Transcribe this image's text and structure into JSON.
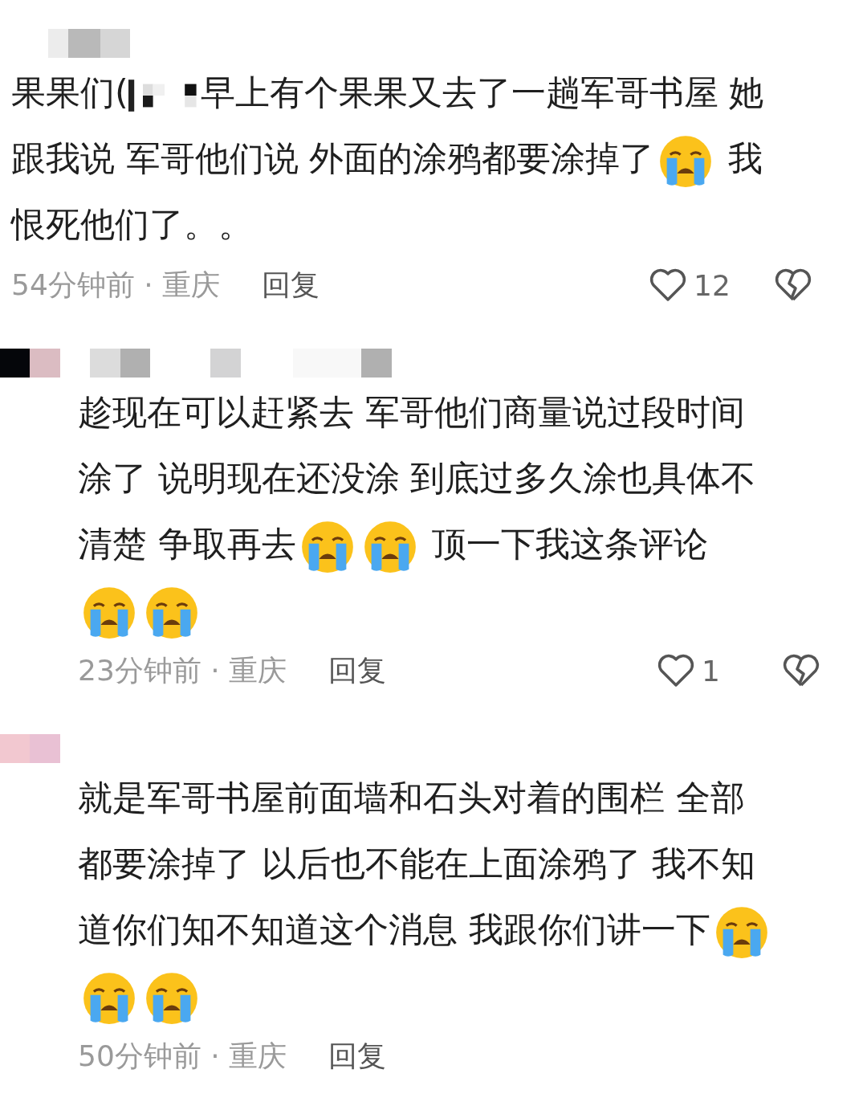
{
  "comments": [
    {
      "reply_level": false,
      "segments": [
        {
          "kind": "text",
          "text": "果果们("
        },
        {
          "kind": "mosaic"
        },
        {
          "kind": "text",
          "text": "早上有个果果又去了一趟军哥书屋 她跟我说 军哥他们说 外面的涂鸦都要涂掉了"
        },
        {
          "kind": "emoji"
        },
        {
          "kind": "text",
          "text": " 我恨死他们了。。"
        }
      ],
      "time": "54分钟前 · 重庆",
      "reply": "回复",
      "likes": "12"
    },
    {
      "reply_level": true,
      "segments": [
        {
          "kind": "text",
          "text": "趁现在可以赶紧去 军哥他们商量说过段时间涂了 说明现在还没涂 到底过多久涂也具体不清楚 争取再去"
        },
        {
          "kind": "emoji"
        },
        {
          "kind": "emoji"
        },
        {
          "kind": "text",
          "text": " 顶一下我这条评论"
        },
        {
          "kind": "emoji"
        },
        {
          "kind": "emoji"
        }
      ],
      "time": "23分钟前 · 重庆",
      "reply": "回复",
      "likes": "1"
    },
    {
      "reply_level": true,
      "segments": [
        {
          "kind": "text",
          "text": "就是军哥书屋前面墙和石头对着的围栏 全部都要涂掉了 以后也不能在上面涂鸦了 我不知道你们知不知道这个消息 我跟你们讲一下"
        },
        {
          "kind": "emoji"
        },
        {
          "kind": "emoji"
        },
        {
          "kind": "emoji"
        }
      ],
      "time": "50分钟前 · 重庆",
      "reply": "回复"
    }
  ]
}
